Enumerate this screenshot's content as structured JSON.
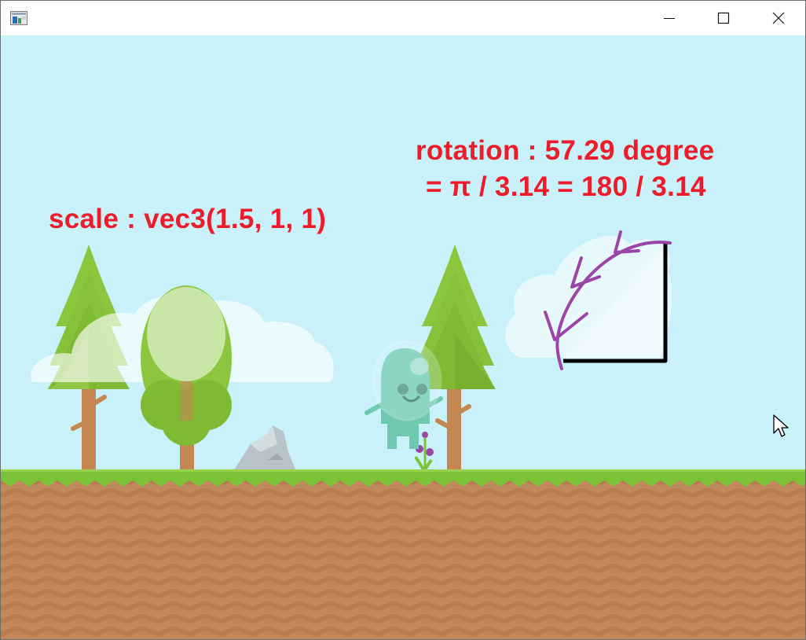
{
  "window": {
    "icon": "app-window-icon",
    "controls": {
      "minimize_icon": "minimize-icon",
      "maximize_icon": "maximize-icon",
      "close_icon": "close-icon"
    }
  },
  "scene": {
    "scale_label": "scale : vec3(1.5, 1, 1)",
    "rotation_line1": "rotation : 57.29 degree",
    "rotation_line2": "= π / 3.14 = 180 / 3.14",
    "label_color": "#ec1c2b",
    "sky_color": "#c8f1fa",
    "grass_color": "#7cc236",
    "ground_color": "#c2875a",
    "arc_color": "#9b45a8"
  }
}
